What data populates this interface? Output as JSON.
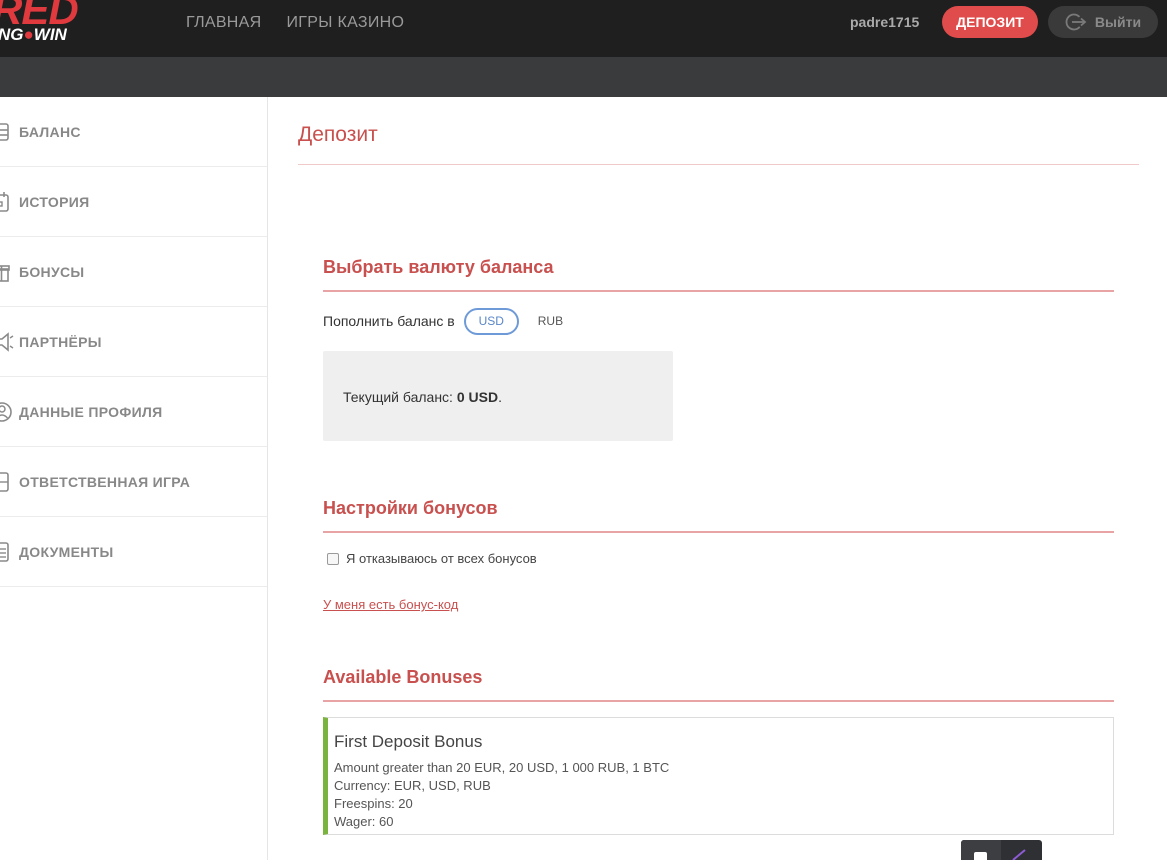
{
  "header": {
    "logo_top": "RED",
    "logo_bottom_left": "NG",
    "logo_bottom_right": "WIN",
    "nav": [
      {
        "label": "ГЛАВНАЯ"
      },
      {
        "label": "ИГРЫ КАЗИНО"
      }
    ],
    "username": "padre1715",
    "deposit_label": "ДЕПОЗИТ",
    "logout_label": "Выйти",
    "accent_color": "#e04b4b"
  },
  "sidebar": {
    "items": [
      {
        "label": "БАЛАНС",
        "icon": "wallet-icon"
      },
      {
        "label": "ИСТОРИЯ",
        "icon": "calendar-icon"
      },
      {
        "label": "БОНУСЫ",
        "icon": "gift-icon"
      },
      {
        "label": "ПАРТНЁРЫ",
        "icon": "megaphone-icon"
      },
      {
        "label": "ДАННЫЕ ПРОФИЛЯ",
        "icon": "user-icon"
      },
      {
        "label": "ОТВЕТСТВЕННАЯ ИГРА",
        "icon": "document-icon"
      },
      {
        "label": "ДОКУМЕНТЫ",
        "icon": "list-icon"
      }
    ]
  },
  "main": {
    "page_title": "Депозит",
    "currency_section": {
      "title": "Выбрать валюту баланса",
      "label": "Пополнить баланс в",
      "options": [
        "USD",
        "RUB"
      ],
      "selected": "USD"
    },
    "balance": {
      "label": "Текущий баланс:",
      "value": "0 USD",
      "suffix": "."
    },
    "bonus_settings": {
      "title": "Настройки бонусов",
      "decline_label": "Я отказываюсь от всех бонусов",
      "decline_checked": false,
      "promo_link": "У меня есть бонус-код"
    },
    "available_bonuses": {
      "title": "Available Bonuses",
      "items": [
        {
          "name": "First Deposit Bonus",
          "lines": [
            "Amount greater than 20 EUR, 20 USD, 1 000 RUB, 1 BTC",
            "Currency: EUR, USD, RUB",
            "Freespins: 20",
            "Wager: 60"
          ]
        }
      ]
    }
  }
}
